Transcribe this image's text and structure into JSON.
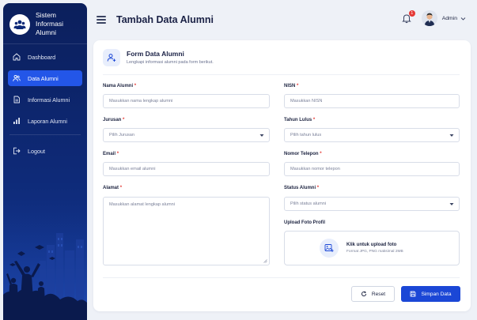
{
  "app": {
    "name_line1": "Sistem Informasi",
    "name_line2": "Alumni"
  },
  "sidebar": {
    "items": [
      {
        "label": "Dashboard",
        "icon": "home-icon",
        "active": false
      },
      {
        "label": "Data Alumni",
        "icon": "users-icon",
        "active": true
      },
      {
        "label": "Informasi Alumni",
        "icon": "document-icon",
        "active": false
      },
      {
        "label": "Laporan Alumni",
        "icon": "bar-chart-icon",
        "active": false
      }
    ],
    "logout_label": "Logout"
  },
  "header": {
    "title": "Tambah Data Alumni",
    "notification_count": "1",
    "user_name": "Admin"
  },
  "form": {
    "title": "Form Data Alumni",
    "subtitle": "Lengkapi informasi alumni pada form berikut.",
    "fields": {
      "nama": {
        "label": "Nama Alumni",
        "placeholder": "Masukkan nama lengkap alumni"
      },
      "nisn": {
        "label": "NISN",
        "placeholder": "Masukkan NISN"
      },
      "jurusan": {
        "label": "Jurusan",
        "value": "Pilih Jurusan"
      },
      "tahun": {
        "label": "Tahun Lulus",
        "value": "Pilih tahun lulus"
      },
      "email": {
        "label": "Email",
        "placeholder": "Masukkan email alumni"
      },
      "telepon": {
        "label": "Nomor Telepon",
        "placeholder": "Masukkan nomor telepon"
      },
      "alamat": {
        "label": "Alamat",
        "placeholder": "Masukkan alamat lengkap alumni"
      },
      "status": {
        "label": "Status Alumni",
        "value": "Pilih status alumni"
      }
    },
    "required_mark": "*",
    "upload": {
      "label": "Upload Foto Profil",
      "title": "Klik untuk upload foto",
      "subtitle": "Format JPG, PNG maksimal 2MB"
    },
    "buttons": {
      "reset": "Reset",
      "save": "Simpan Data"
    }
  },
  "colors": {
    "sidebar_bg": "#0e2a78",
    "accent": "#1b47d6",
    "active_item": "#2356e8",
    "required": "#e53935"
  }
}
